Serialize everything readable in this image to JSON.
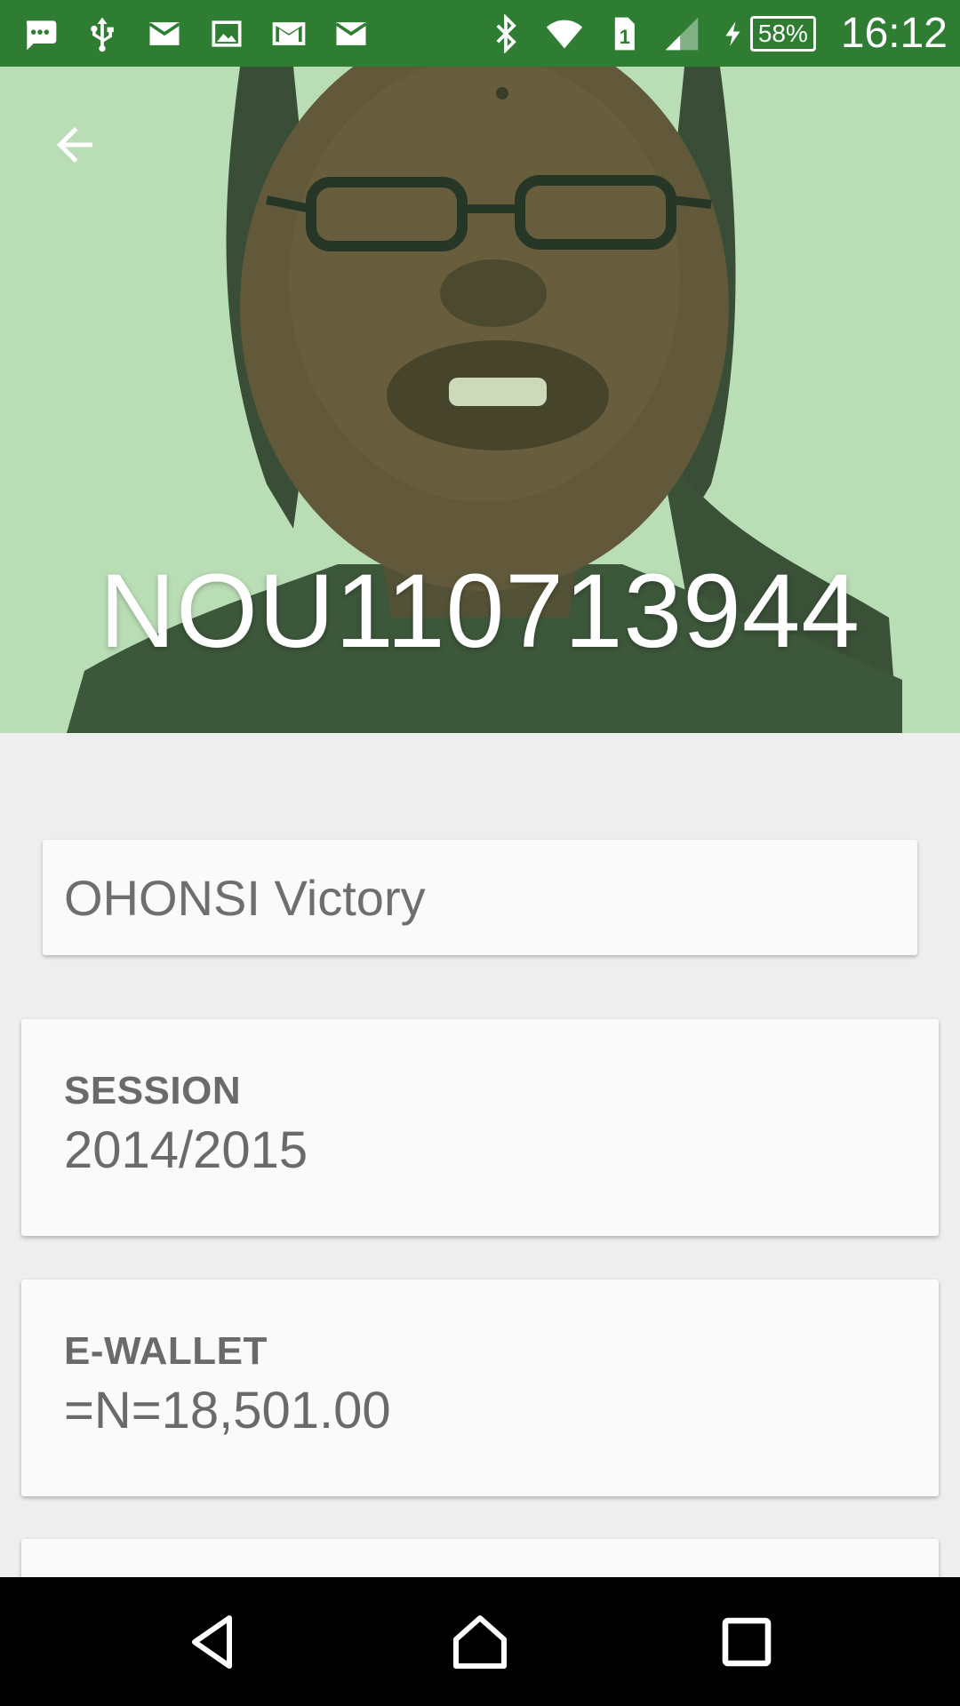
{
  "status_bar": {
    "icons": [
      "chat-icon",
      "usb-icon",
      "email-icon",
      "image-icon",
      "gmail-icon",
      "email-icon",
      "bluetooth-icon",
      "wifi-icon",
      "sim-1-icon",
      "signal-icon",
      "charging-icon"
    ],
    "battery": "58%",
    "time": "16:12",
    "color": "#2e7d32"
  },
  "header": {
    "matric_number": "NOU110713944",
    "back_icon": "arrow-back-icon"
  },
  "profile": {
    "name": "OHONSI Victory"
  },
  "cards": {
    "session": {
      "label": "SESSION",
      "value": "2014/2015"
    },
    "wallet": {
      "label": "E-WALLET",
      "value": "=N=18,501.00"
    }
  },
  "nav": {
    "icons": [
      "back-triangle-icon",
      "home-icon",
      "recents-icon"
    ]
  }
}
